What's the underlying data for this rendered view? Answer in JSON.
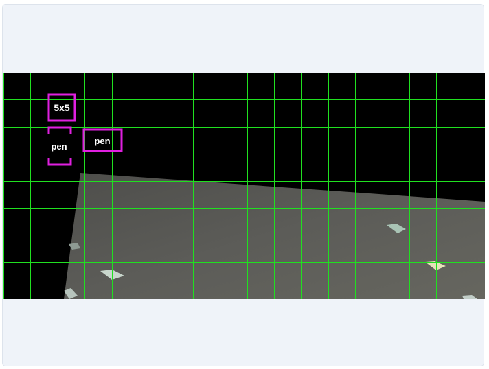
{
  "colors": {
    "page_background": "#eff3f9",
    "grid_line": "#20e020",
    "box_outline": "#e020e0",
    "video_background": "#000000",
    "table_surface": "#5a5a56"
  },
  "grid": {
    "columns": 18,
    "rows": 8
  },
  "detections": [
    {
      "label": "5x5",
      "style": "full-box"
    },
    {
      "label": "pen",
      "style": "bracket-box"
    },
    {
      "label": "pen",
      "style": "full-box"
    }
  ]
}
